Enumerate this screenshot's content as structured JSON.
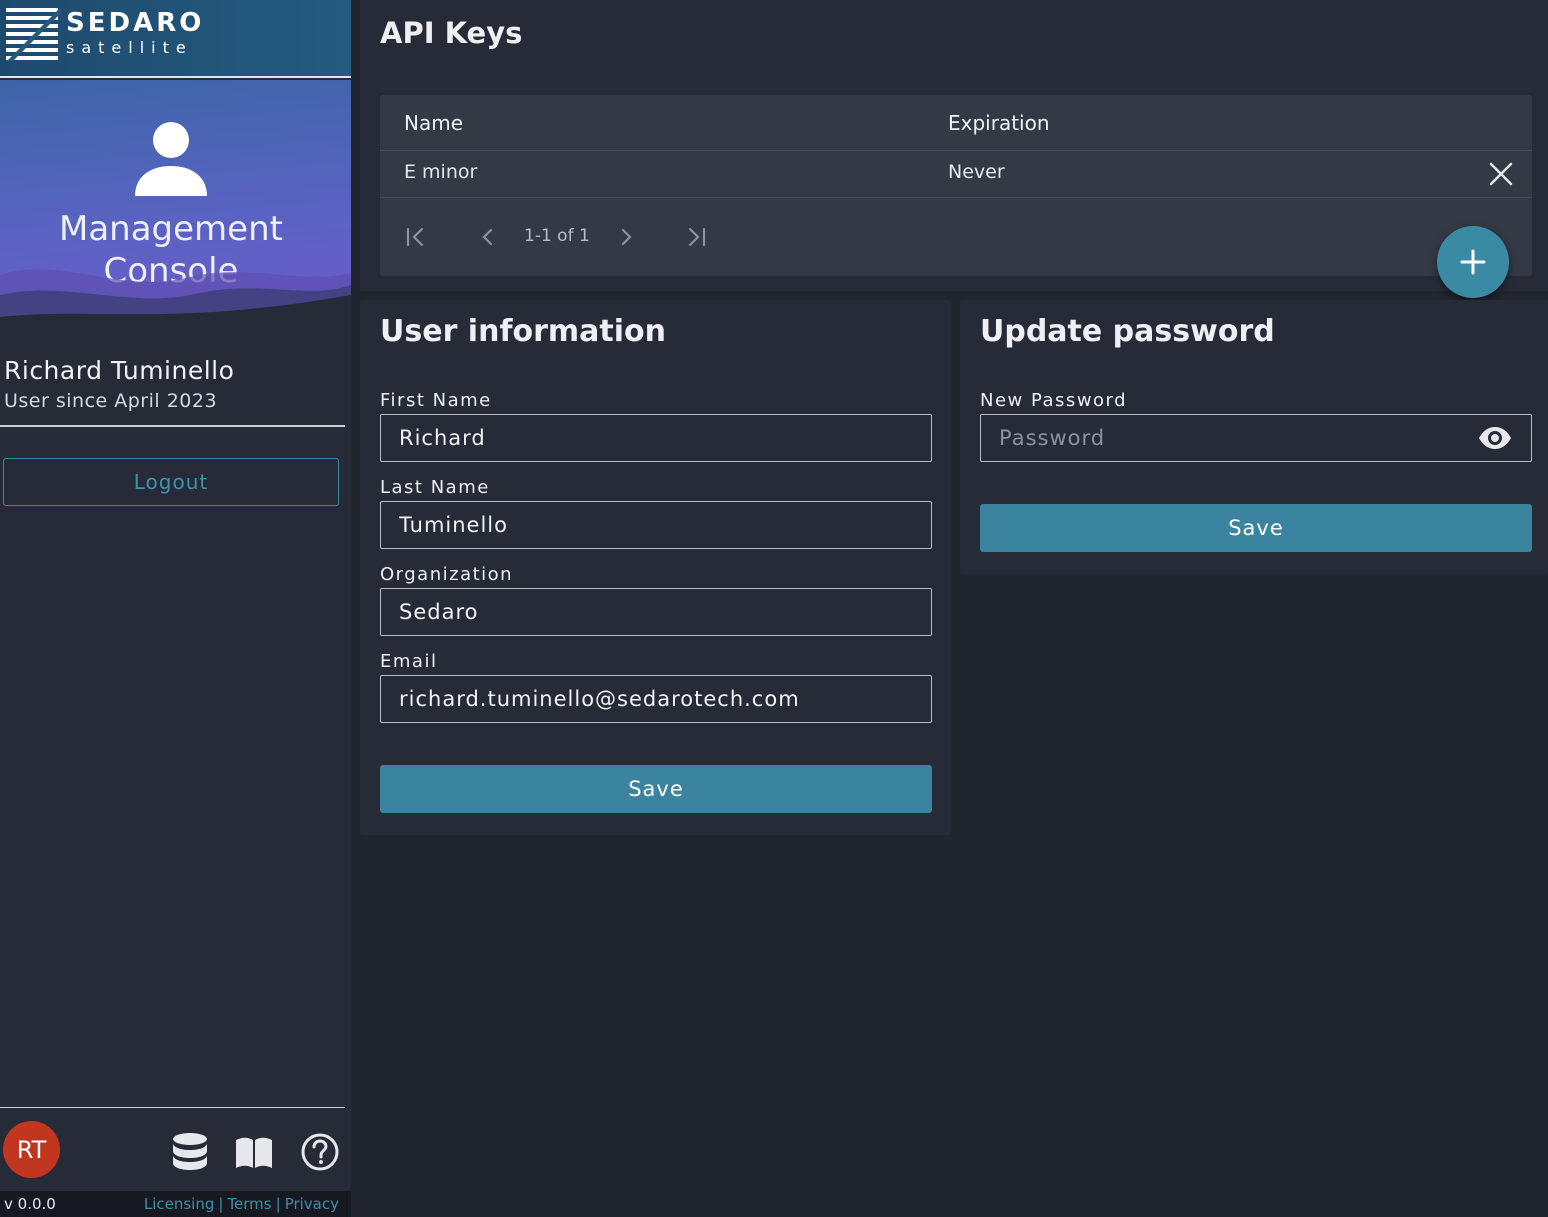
{
  "brand": {
    "name": "SEDARO",
    "sub": "satellite"
  },
  "sidebar": {
    "hero_title": "Management Console",
    "user_name": "Richard Tuminello",
    "user_since": "User since April 2023",
    "logout_label": "Logout",
    "avatar_initials": "RT",
    "avatar_color": "#c0361f",
    "footer_icons": [
      "database-icon",
      "book-icon",
      "help-circle-icon"
    ],
    "version": "v 0.0.0",
    "links": {
      "licensing": "Licensing",
      "terms": "Terms",
      "privacy": "Privacy",
      "separator": "|"
    }
  },
  "api_keys": {
    "title": "API Keys",
    "columns": {
      "name": "Name",
      "expiration": "Expiration"
    },
    "rows": [
      {
        "name": "E minor",
        "expiration": "Never"
      }
    ],
    "pagination": {
      "range": "1-1 of 1"
    },
    "add_icon": "plus-icon"
  },
  "user_info": {
    "title": "User information",
    "first_name": {
      "label": "First Name",
      "value": "Richard"
    },
    "last_name": {
      "label": "Last Name",
      "value": "Tuminello"
    },
    "organization": {
      "label": "Organization",
      "value": "Sedaro"
    },
    "email": {
      "label": "Email",
      "value": "richard.tuminello@sedarotech.com"
    },
    "save_label": "Save"
  },
  "update_password": {
    "title": "Update password",
    "new_password": {
      "label": "New Password",
      "value": "",
      "placeholder": "Password"
    },
    "save_label": "Save"
  },
  "colors": {
    "accent": "#3b849f",
    "background": "#202530",
    "panel": "#262b37",
    "table": "#343946"
  }
}
